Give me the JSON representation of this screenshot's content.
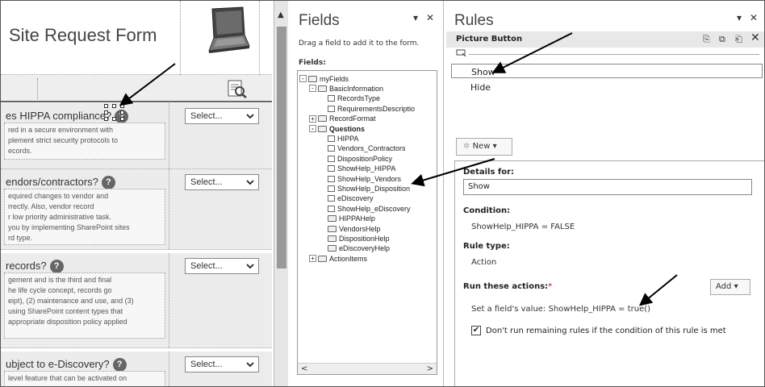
{
  "form": {
    "title": "Site Request Form",
    "questions": [
      {
        "text": "es HIPPA compliance?",
        "help": "?",
        "desc": "red in a secure environment with\nplement strict security protocols to\necords.",
        "select": "Select..."
      },
      {
        "text": "endors/contractors?",
        "help": "?",
        "desc": "equired changes to vendor and\nrrectly.  Also, vendor record\nr low priority administrative task.\nyou by implementing SharePoint sites\nrd type.",
        "select": "Select..."
      },
      {
        "text": "records?",
        "help": "?",
        "desc": "gement and is the third and final\nhe life cycle concept, records go\neipt), (2) maintenance and use, and (3)\n using SharePoint content types that\nappropriate disposition policy applied",
        "select": "Select..."
      },
      {
        "text": "ubject to e-Discovery?",
        "help": "?",
        "desc": "level feature that can be activated on",
        "select": "Select..."
      }
    ]
  },
  "fields_pane": {
    "title": "Fields",
    "hint": "Drag a field to add it to the form.",
    "fields_label": "Fields:",
    "tree": [
      {
        "label": "myFields",
        "level": 0,
        "kind": "folder",
        "exp": "-"
      },
      {
        "label": "BasicInformation",
        "level": 1,
        "kind": "folder",
        "exp": "-"
      },
      {
        "label": "RecordsType",
        "level": 2,
        "kind": "doc"
      },
      {
        "label": "RequirementsDescriptio",
        "level": 2,
        "kind": "doc"
      },
      {
        "label": "RecordFormat",
        "level": 1,
        "kind": "folder",
        "exp": "+"
      },
      {
        "label": "Questions",
        "level": 1,
        "kind": "folder",
        "exp": "-",
        "bold": true
      },
      {
        "label": "HIPPA",
        "level": 2,
        "kind": "doc"
      },
      {
        "label": "Vendors_Contractors",
        "level": 2,
        "kind": "doc"
      },
      {
        "label": "DispositionPolicy",
        "level": 2,
        "kind": "doc"
      },
      {
        "label": "ShowHelp_HIPPA",
        "level": 2,
        "kind": "doc"
      },
      {
        "label": "ShowHelp_Vendors",
        "level": 2,
        "kind": "doc"
      },
      {
        "label": "ShowHelp_Disposition",
        "level": 2,
        "kind": "doc"
      },
      {
        "label": "eDiscovery",
        "level": 2,
        "kind": "doc"
      },
      {
        "label": "ShowHelp_eDiscovery",
        "level": 2,
        "kind": "doc"
      },
      {
        "label": "HIPPAHelp",
        "level": 2,
        "kind": "folder"
      },
      {
        "label": "VendorsHelp",
        "level": 2,
        "kind": "folder"
      },
      {
        "label": "DispositionHelp",
        "level": 2,
        "kind": "folder"
      },
      {
        "label": "eDiscoveryHelp",
        "level": 2,
        "kind": "folder"
      },
      {
        "label": "ActionItems",
        "level": 1,
        "kind": "folder",
        "exp": "+"
      }
    ]
  },
  "rules_pane": {
    "title": "Rules",
    "subtitle": "Picture Button",
    "rules": [
      "Show",
      "Hide"
    ],
    "new_label": "New",
    "details_for_label": "Details for:",
    "details_for_value": "Show",
    "condition_label": "Condition:",
    "condition_value": "ShowHelp_HIPPA = FALSE",
    "rule_type_label": "Rule type:",
    "rule_type_value": "Action",
    "run_actions_label": "Run these actions:",
    "run_actions_required": "*",
    "add_label": "Add",
    "action_value": "Set a field's value: ShowHelp_HIPPA = true()",
    "checkbox_label": "Don't run remaining rules if the condition of this rule is met",
    "checkbox_checked": true
  },
  "icons": {
    "close": "✕",
    "dropdown": "▾",
    "check": "✔",
    "up": "▲",
    "left": "<",
    "right": ">"
  }
}
